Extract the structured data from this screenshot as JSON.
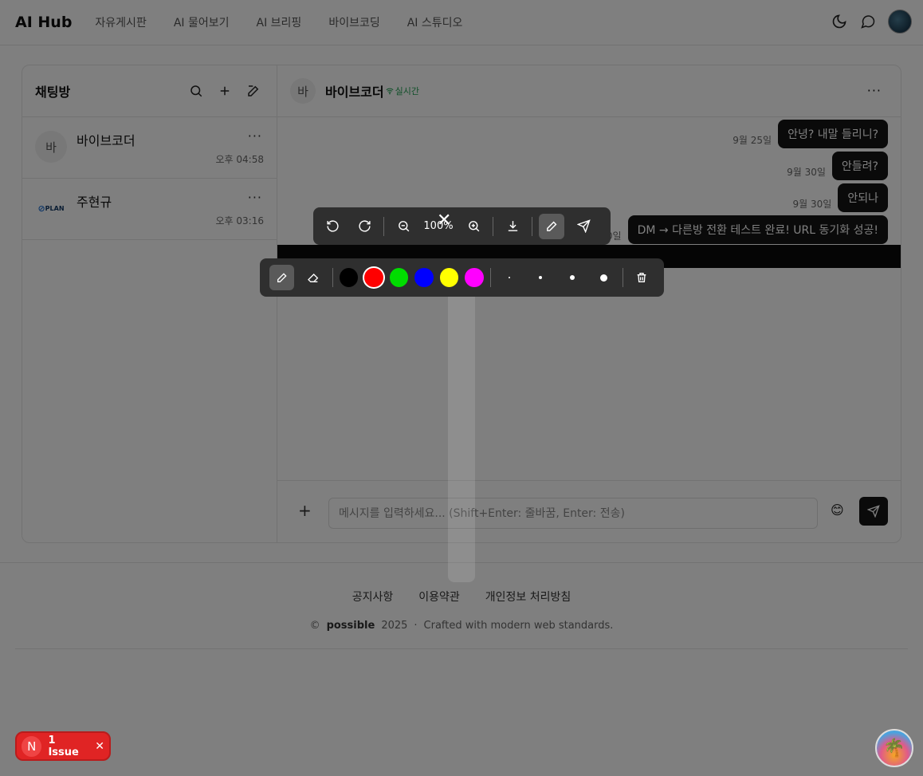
{
  "header": {
    "logo": "AI Hub",
    "nav": [
      "자유게시판",
      "AI 물어보기",
      "AI 브리핑",
      "바이브코딩",
      "AI 스튜디오"
    ]
  },
  "sidebar": {
    "title": "채팅방",
    "rooms": [
      {
        "avatar": "바",
        "name": "바이브코더",
        "time": "오후 04:58"
      },
      {
        "avatar": "PLAN",
        "name": "주현규",
        "time": "오후 03:16"
      }
    ]
  },
  "chat": {
    "avatar": "바",
    "name": "바이브코더",
    "status": "실시간",
    "messages": [
      {
        "date": "9월 25일",
        "text": "안녕? 내말 들리니?"
      },
      {
        "date": "9월 30일",
        "text": "안들려?"
      },
      {
        "date": "9월 30일",
        "text": "안되나"
      },
      {
        "date": "9월 30일",
        "text": "DM → 다른방 전환 테스트 완료! URL 동기화 성공!"
      }
    ],
    "composer": {
      "placeholder": "메시지를 입력하세요... (Shift+Enter: 줄바꿈, Enter: 전송)",
      "emoji": "😊"
    }
  },
  "image_viewer": {
    "zoom": "100%",
    "close": "✕",
    "colors": [
      "#000000",
      "#ff0000",
      "#00dd00",
      "#0000ff",
      "#ffff00",
      "#ff00ff"
    ],
    "selected_color": "#ff0000"
  },
  "footer": {
    "links": [
      "공지사항",
      "이용약관",
      "개인정보 처리방침"
    ],
    "copyright_symbol": "©",
    "brand": "possible",
    "year": "2025",
    "separator": "·",
    "tagline": "Crafted with modern web standards."
  },
  "issue_badge": {
    "letter": "N",
    "text": "1 Issue"
  }
}
